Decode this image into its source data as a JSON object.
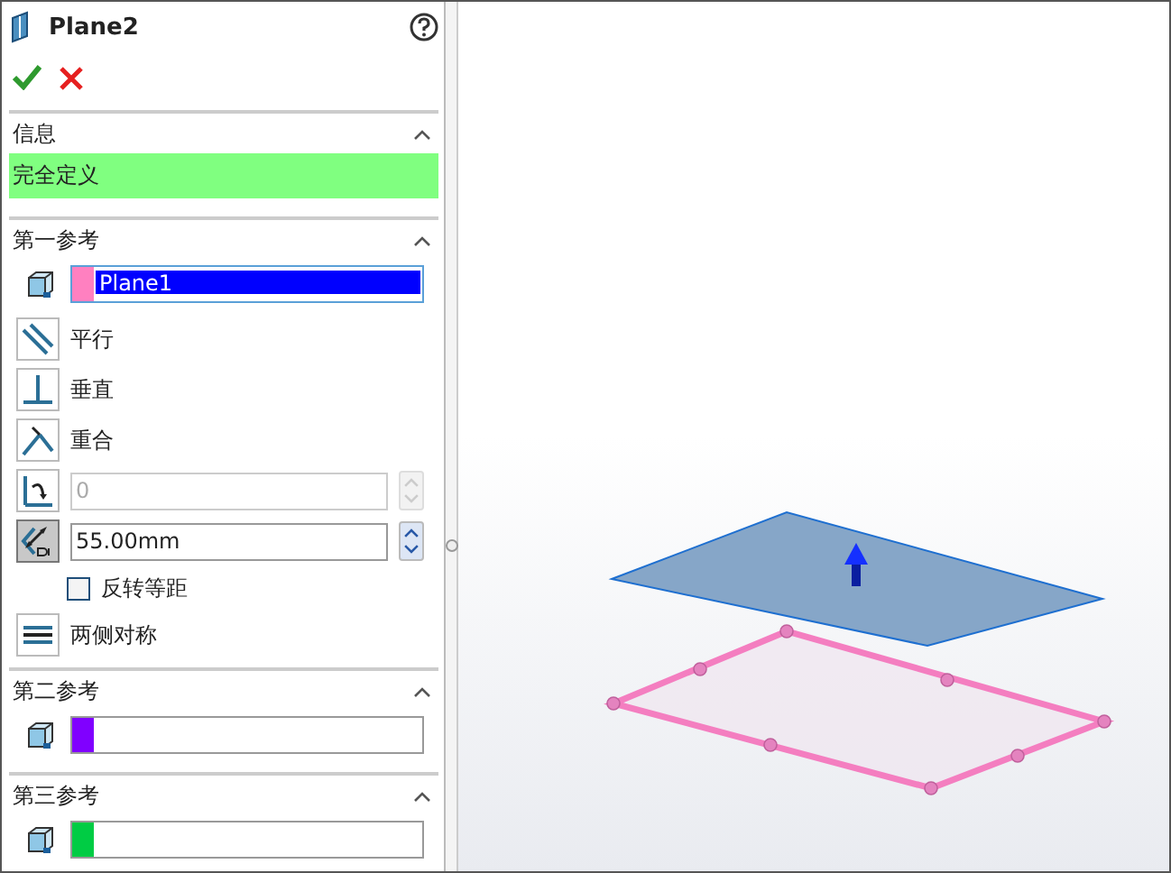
{
  "title": "Plane2",
  "actions": [
    {
      "kind": "ok"
    },
    {
      "kind": "cancel"
    }
  ],
  "sections": [
    {
      "title": "信息",
      "expanded": true,
      "message": "完全定义"
    },
    {
      "title": "第一参考",
      "expanded": true,
      "selection": {
        "value": "Plane1",
        "color": "#ff80c0",
        "selected": true
      },
      "options": [
        {
          "kind": "parallel",
          "label": "平行",
          "selected": false
        },
        {
          "kind": "perpendicular",
          "label": "垂直",
          "selected": false
        },
        {
          "kind": "coincident",
          "label": "重合",
          "selected": false
        },
        {
          "kind": "angle",
          "value": "0",
          "selected": false,
          "disabled": true
        },
        {
          "kind": "distance",
          "value": "55.00mm",
          "selected": true,
          "disabled": false
        },
        {
          "kind": "checkbox",
          "label": "反转等距",
          "checked": false
        },
        {
          "kind": "symmetric",
          "label": "两侧对称",
          "selected": false
        }
      ]
    },
    {
      "title": "第二参考",
      "expanded": true,
      "selection": {
        "color": "#8000ff",
        "selected": false
      }
    },
    {
      "title": "第三参考",
      "expanded": true,
      "selection": {
        "color": "#00cc44",
        "selected": false
      }
    }
  ]
}
